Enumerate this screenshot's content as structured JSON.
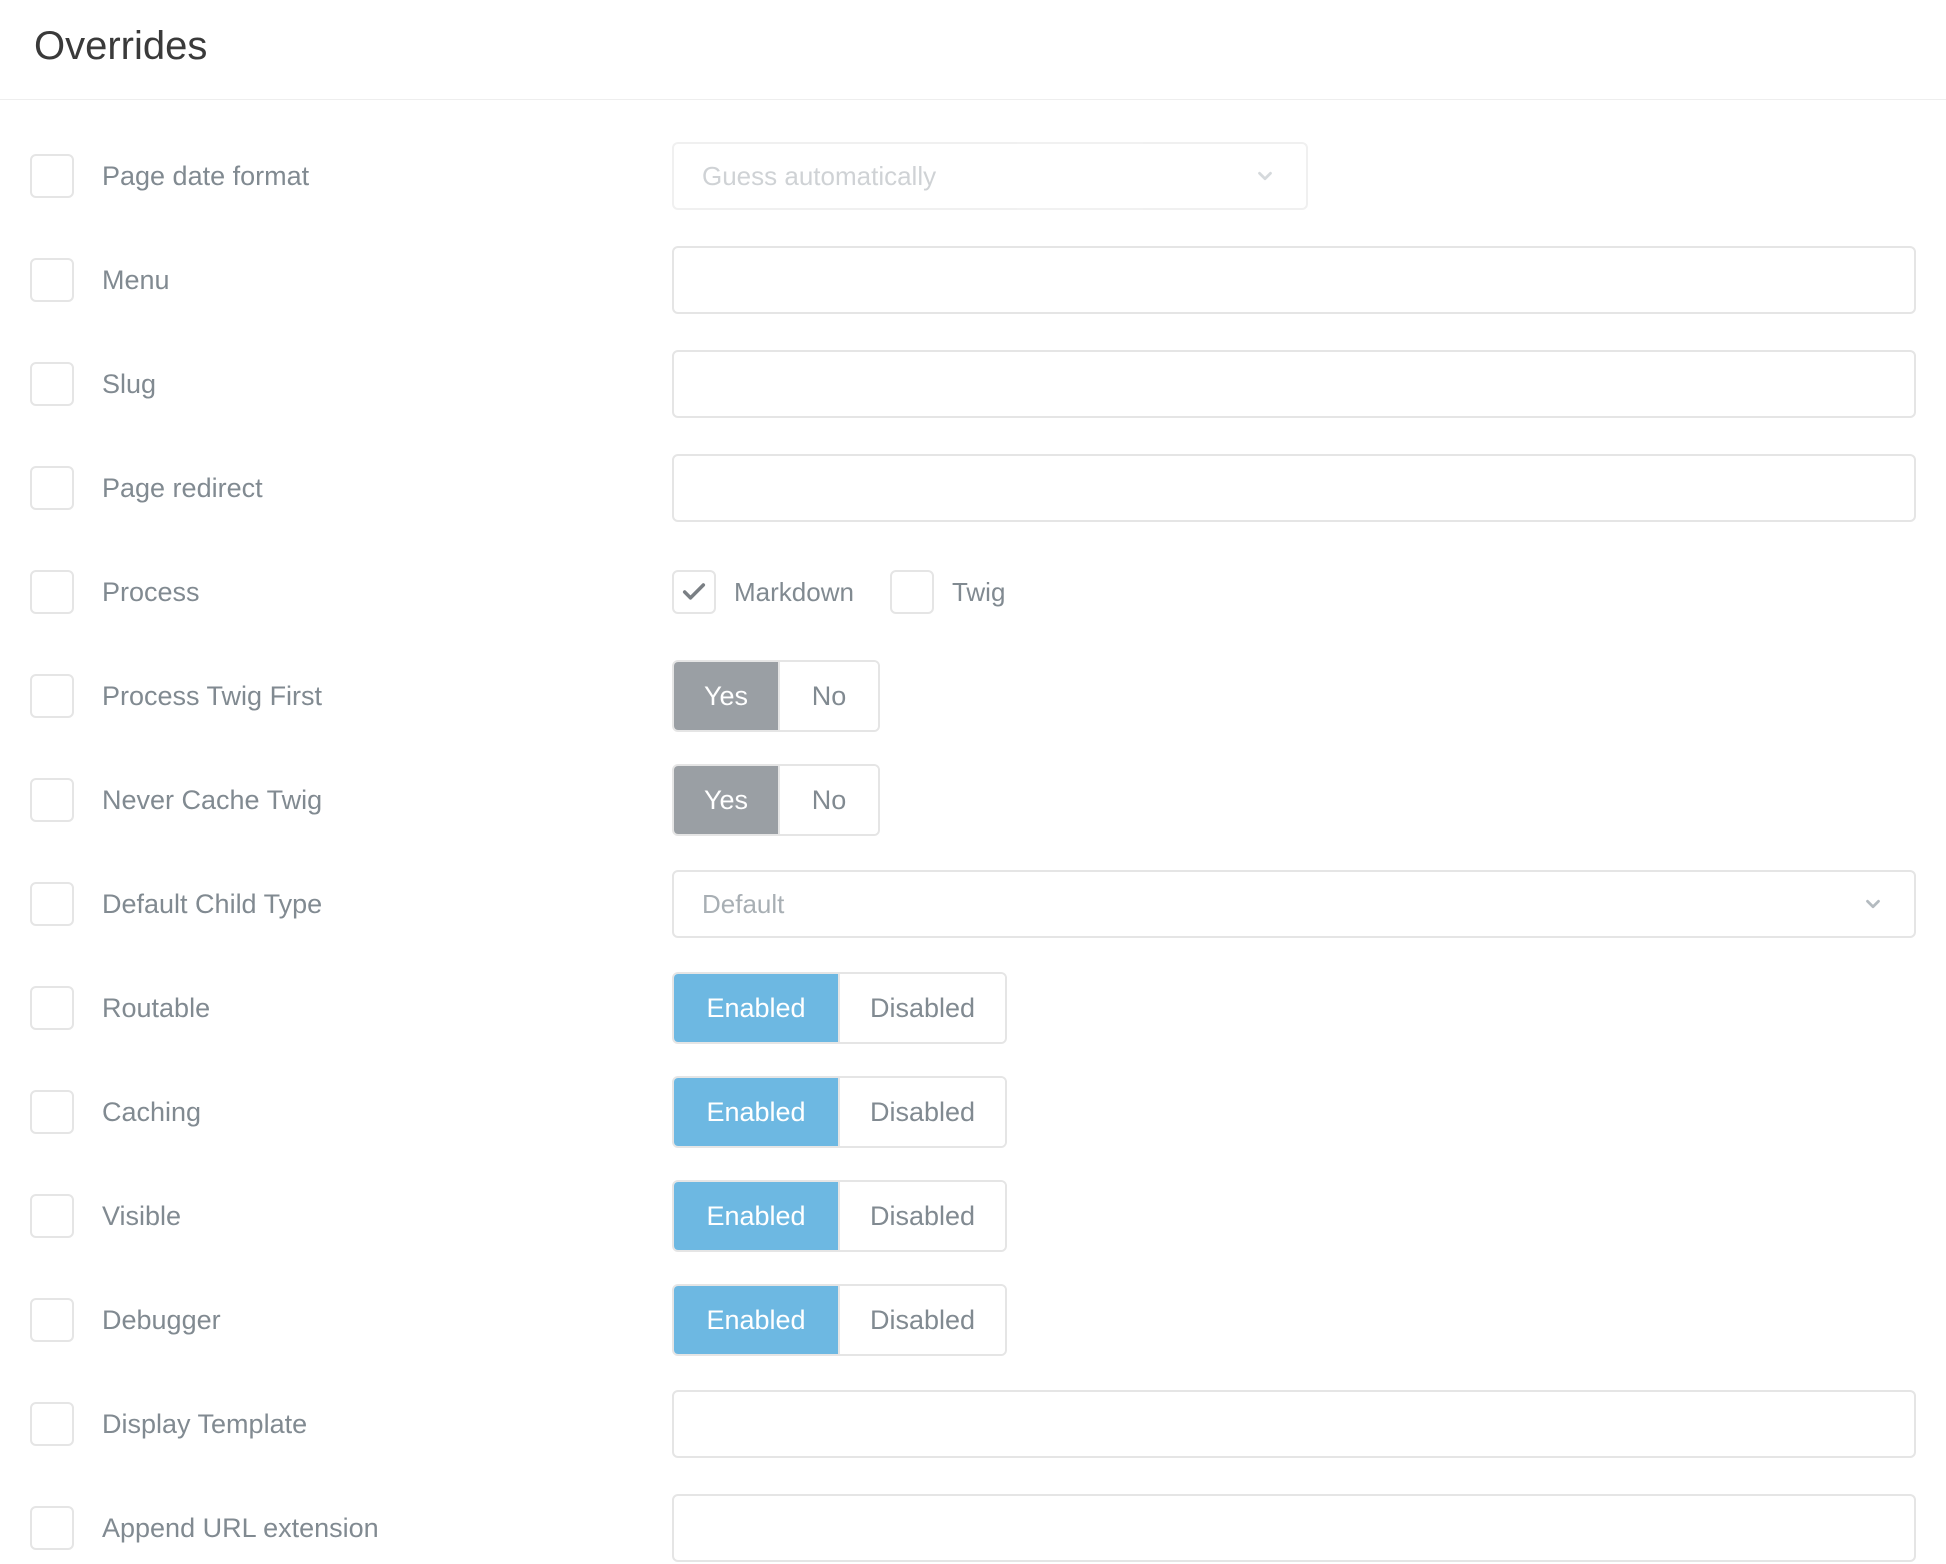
{
  "section": {
    "title": "Overrides"
  },
  "labels": {
    "page_date_format": "Page date format",
    "menu": "Menu",
    "slug": "Slug",
    "page_redirect": "Page redirect",
    "process": "Process",
    "process_twig_first": "Process Twig First",
    "never_cache_twig": "Never Cache Twig",
    "default_child_type": "Default Child Type",
    "routable": "Routable",
    "caching": "Caching",
    "visible": "Visible",
    "debugger": "Debugger",
    "display_template": "Display Template",
    "append_url_extension": "Append URL extension"
  },
  "page_date_format": {
    "value": "Guess automatically"
  },
  "menu": {
    "value": ""
  },
  "slug": {
    "value": ""
  },
  "page_redirect": {
    "value": ""
  },
  "process": {
    "markdown": {
      "label": "Markdown",
      "checked": true
    },
    "twig": {
      "label": "Twig",
      "checked": false
    }
  },
  "yes": "Yes",
  "no": "No",
  "enabled": "Enabled",
  "disabled": "Disabled",
  "process_twig_first": {
    "value": "Yes"
  },
  "never_cache_twig": {
    "value": "Yes"
  },
  "default_child_type": {
    "value": "Default"
  },
  "routable": {
    "value": "Enabled"
  },
  "caching": {
    "value": "Enabled"
  },
  "visible": {
    "value": "Enabled"
  },
  "debugger": {
    "value": "Enabled"
  },
  "display_template": {
    "value": ""
  },
  "append_url_extension": {
    "value": ""
  }
}
